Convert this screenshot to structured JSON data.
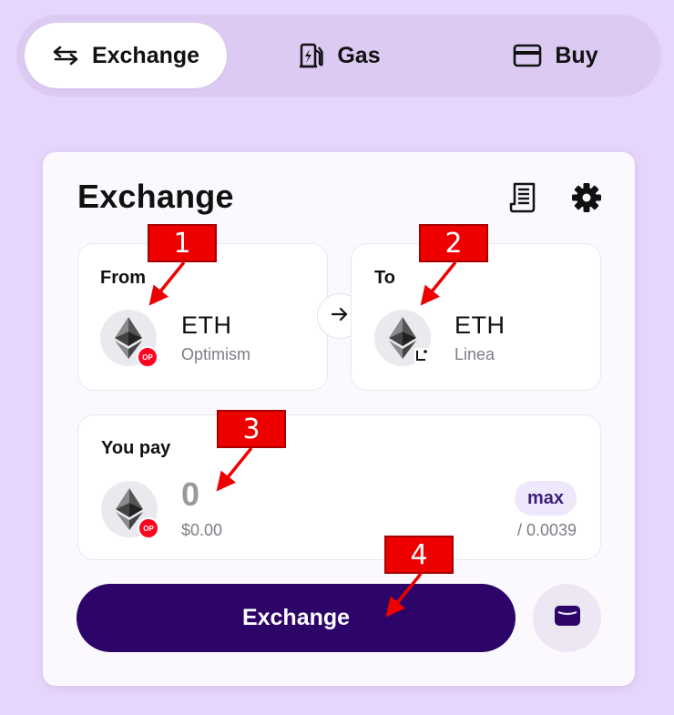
{
  "tabs": [
    {
      "label": "Exchange",
      "icon": "swap-arrows-icon",
      "active": true
    },
    {
      "label": "Gas",
      "icon": "gas-pump-icon",
      "active": false
    },
    {
      "label": "Buy",
      "icon": "credit-card-icon",
      "active": false
    }
  ],
  "card": {
    "title": "Exchange",
    "header_icons": [
      "receipt-icon",
      "gear-icon"
    ]
  },
  "from": {
    "label": "From",
    "token": "ETH",
    "network": "Optimism",
    "badge": "OP"
  },
  "to": {
    "label": "To",
    "token": "ETH",
    "network": "Linea"
  },
  "pay": {
    "label": "You pay",
    "amount": "0",
    "usd_value": "$0.00",
    "max_label": "max",
    "balance": "/ 0.0039",
    "badge": "OP"
  },
  "actions": {
    "exchange_label": "Exchange",
    "wallet_icon": "wallet-icon"
  },
  "annotations": [
    "1",
    "2",
    "3",
    "4"
  ],
  "colors": {
    "page_bg": "#e7d6fb",
    "primary": "#2d0569",
    "op_red": "#ff0420",
    "marker_red": "#ee0000"
  }
}
